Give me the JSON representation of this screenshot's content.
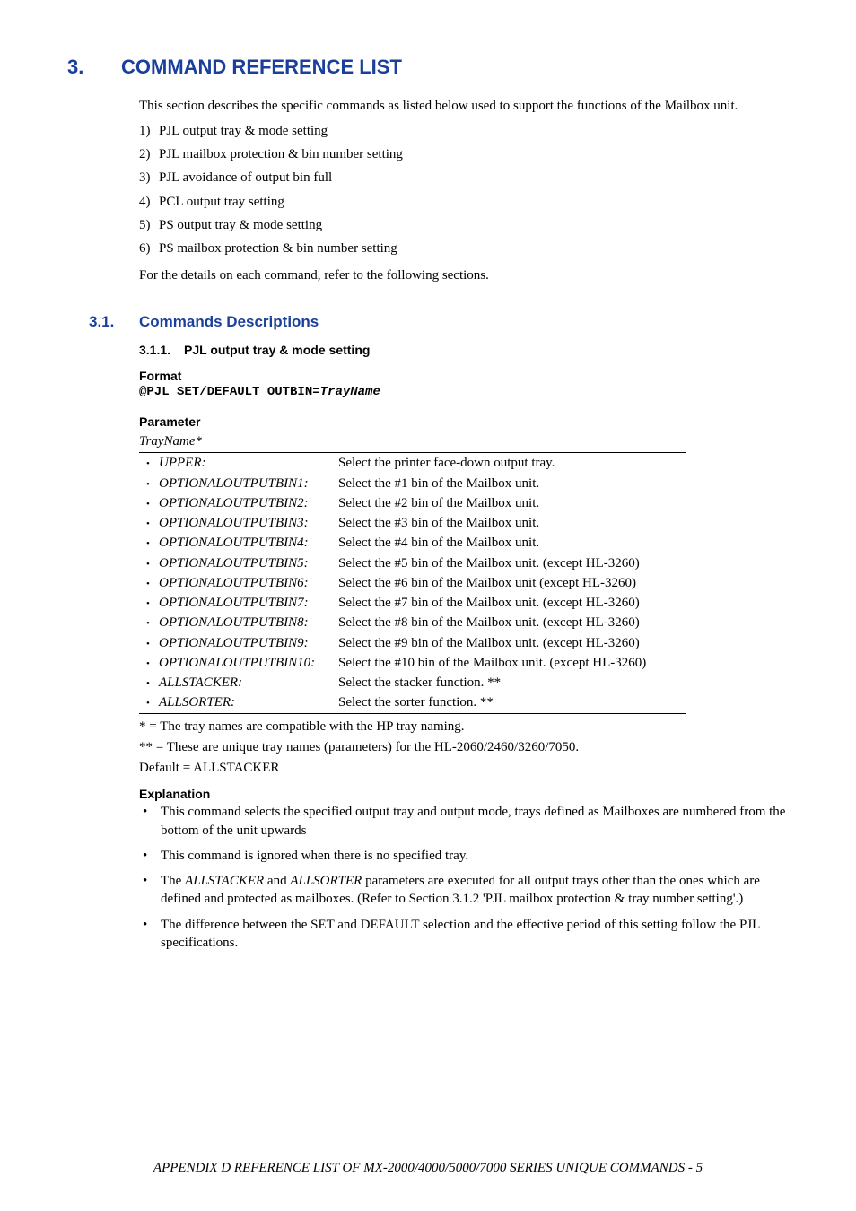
{
  "h1": {
    "num": "3.",
    "title": "COMMAND REFERENCE LIST"
  },
  "intro": "This section describes the specific commands as listed below used to support the functions of the Mailbox unit.",
  "list": [
    {
      "n": "1)",
      "t": "PJL output tray & mode setting"
    },
    {
      "n": "2)",
      "t": "PJL mailbox protection & bin number setting"
    },
    {
      "n": "3)",
      "t": "PJL avoidance of output bin full"
    },
    {
      "n": "4)",
      "t": "PCL output tray setting"
    },
    {
      "n": "5)",
      "t": "PS output tray & mode setting"
    },
    {
      "n": "6)",
      "t": "PS mailbox protection & bin number setting"
    }
  ],
  "closing": "For the details on each command, refer to the following sections.",
  "h2": {
    "num": "3.1.",
    "title": "Commands Descriptions"
  },
  "h3": {
    "num": "3.1.1.",
    "title": "PJL output tray & mode setting"
  },
  "format_label": "Format",
  "format_code_prefix": "@PJL SET/DEFAULT OUTBIN=",
  "format_code_var": "TrayName",
  "parameter_label": "Parameter",
  "param_name": "TrayName*",
  "params": [
    {
      "k": "UPPER:",
      "v": "Select the printer face-down output tray."
    },
    {
      "k": "OPTIONALOUTPUTBIN1:",
      "v": "Select the #1 bin of the Mailbox unit."
    },
    {
      "k": "OPTIONALOUTPUTBIN2:",
      "v": "Select the #2 bin of the Mailbox unit."
    },
    {
      "k": "OPTIONALOUTPUTBIN3:",
      "v": "Select the #3 bin of the Mailbox unit."
    },
    {
      "k": "OPTIONALOUTPUTBIN4:",
      "v": "Select the #4 bin of the Mailbox unit."
    },
    {
      "k": "OPTIONALOUTPUTBIN5:",
      "v": "Select the #5 bin of the Mailbox unit. (except HL-3260)"
    },
    {
      "k": "OPTIONALOUTPUTBIN6:",
      "v": "Select the #6 bin of the Mailbox unit (except HL-3260)"
    },
    {
      "k": "OPTIONALOUTPUTBIN7:",
      "v": "Select the #7 bin of the Mailbox unit. (except HL-3260)"
    },
    {
      "k": "OPTIONALOUTPUTBIN8:",
      "v": "Select the #8 bin of the Mailbox unit. (except HL-3260)"
    },
    {
      "k": "OPTIONALOUTPUTBIN9:",
      "v": "Select the #9 bin of the Mailbox unit. (except HL-3260)"
    },
    {
      "k": "OPTIONALOUTPUTBIN10:",
      "v": "Select the #10 bin of the Mailbox unit. (except HL-3260)"
    },
    {
      "k": "ALLSTACKER:",
      "v": "Select the stacker function.  **"
    },
    {
      "k": "ALLSORTER:",
      "v": "Select the sorter function.  **"
    }
  ],
  "notes": {
    "n1": "* = The tray names are compatible with the HP tray naming.",
    "n2": "** = These are unique tray names (parameters) for the HL-2060/2460/3260/7050.",
    "n3": "Default = ALLSTACKER"
  },
  "explanation_label": "Explanation",
  "explanations": {
    "e1": "This command selects the specified output tray and output mode, trays defined as Mailboxes are numbered from the bottom of the unit upwards",
    "e2": "This command is ignored when there is no specified tray.",
    "e3_pre": "The ",
    "e3_w1": "ALLSTACKER",
    "e3_mid": " and ",
    "e3_w2": "ALLSORTER",
    "e3_post": " parameters are executed for all output trays other than the ones which are defined and protected as mailboxes.   (Refer to Section 3.1.2 'PJL mailbox protection & tray number setting'.)",
    "e4": "The difference between the SET and DEFAULT selection and the effective period of this setting follow the PJL specifications."
  },
  "footer": "APPENDIX D REFERENCE LIST OF MX-2000/4000/5000/7000 SERIES UNIQUE COMMANDS - 5"
}
